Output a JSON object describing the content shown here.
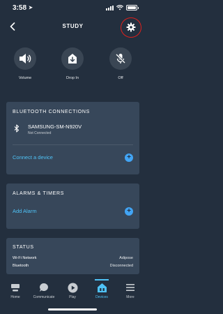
{
  "status_bar": {
    "time": "3:58"
  },
  "header": {
    "title": "STUDY"
  },
  "quick_actions": [
    {
      "label": "Volume",
      "icon": "speaker-icon"
    },
    {
      "label": "Drop In",
      "icon": "drop-in-icon"
    },
    {
      "label": "Off",
      "icon": "microphone-off-icon"
    }
  ],
  "bluetooth": {
    "heading": "BLUETOOTH CONNECTIONS",
    "device_name": "SAMSUNG-SM-N920V",
    "device_status": "Not Connected",
    "connect_label": "Connect a device"
  },
  "alarms": {
    "heading": "ALARMS & TIMERS",
    "add_label": "Add Alarm"
  },
  "status": {
    "heading": "STATUS",
    "rows": [
      {
        "key": "Wi-Fi Network",
        "value": "Adipose"
      },
      {
        "key": "Bluetooth",
        "value": "Disconnected"
      }
    ]
  },
  "bottom_nav": [
    {
      "label": "Home",
      "icon": "home-icon"
    },
    {
      "label": "Communicate",
      "icon": "chat-bubble-icon"
    },
    {
      "label": "Play",
      "icon": "play-icon"
    },
    {
      "label": "Devices",
      "icon": "devices-icon",
      "active": true
    },
    {
      "label": "More",
      "icon": "menu-icon"
    }
  ],
  "colors": {
    "background": "#232f3e",
    "card": "#37475a",
    "accent": "#4fc3f7",
    "highlight_ring": "#e0201c"
  }
}
